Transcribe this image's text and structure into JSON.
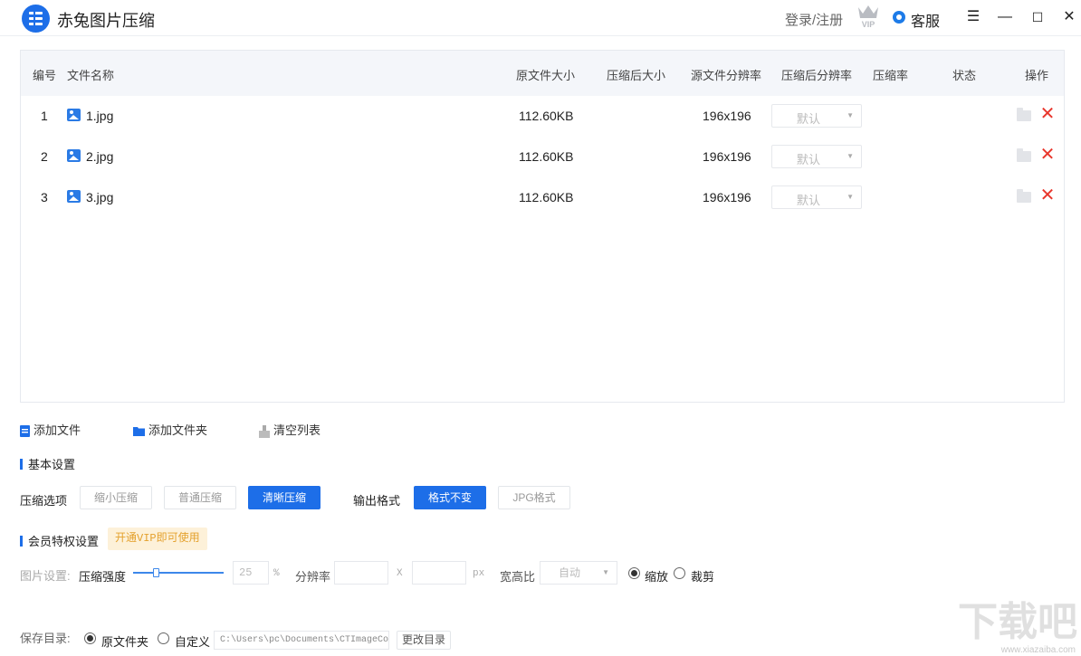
{
  "app": {
    "title": "赤兔图片压缩",
    "login_label": "登录/注册",
    "vip_label": "VIP",
    "service_label": "客服",
    "accent_color": "#1d6ee8"
  },
  "table": {
    "columns": [
      "编号",
      "文件名称",
      "原文件大小",
      "压缩后大小",
      "源文件分辨率",
      "压缩后分辨率",
      "压缩率",
      "状态",
      "操作"
    ],
    "rows": [
      {
        "index": "1",
        "name": "1.jpg",
        "original_size": "112.60KB",
        "compressed_size": "",
        "source_resolution": "196x196",
        "target_resolution": "默认",
        "ratio": "",
        "status": ""
      },
      {
        "index": "2",
        "name": "2.jpg",
        "original_size": "112.60KB",
        "compressed_size": "",
        "source_resolution": "196x196",
        "target_resolution": "默认",
        "ratio": "",
        "status": ""
      },
      {
        "index": "3",
        "name": "3.jpg",
        "original_size": "112.60KB",
        "compressed_size": "",
        "source_resolution": "196x196",
        "target_resolution": "默认",
        "ratio": "",
        "status": ""
      }
    ]
  },
  "actions": {
    "add_file": "添加文件",
    "add_folder": "添加文件夹",
    "clear_list": "清空列表"
  },
  "basic": {
    "heading": "基本设置",
    "compress_label": "压缩选项",
    "compress_options": [
      "缩小压缩",
      "普通压缩",
      "清晰压缩"
    ],
    "compress_selected": "清晰压缩",
    "format_label": "输出格式",
    "format_options": [
      "格式不变",
      "JPG格式"
    ],
    "format_selected": "格式不变"
  },
  "vip": {
    "heading": "会员特权设置",
    "badge": "开通VIP即可使用",
    "image_settings_label": "图片设置:",
    "strength_label": "压缩强度",
    "strength_value": "25",
    "strength_unit": "%",
    "strength_slider_level": 25,
    "resolution_label": "分辨率",
    "times": "X",
    "px_unit": "px",
    "aspect_label": "宽高比",
    "aspect_value": "自动",
    "scale_option": "缩放",
    "crop_option": "裁剪",
    "scale_selected": true
  },
  "save": {
    "label": "保存目录:",
    "original_folder": "原文件夹",
    "custom": "自定义",
    "path": "C:\\Users\\pc\\Documents\\CTImageCo",
    "change_button": "更改目录",
    "original_selected": true
  },
  "watermark": {
    "text": "下载吧",
    "url": "www.xiazaiba.com"
  }
}
